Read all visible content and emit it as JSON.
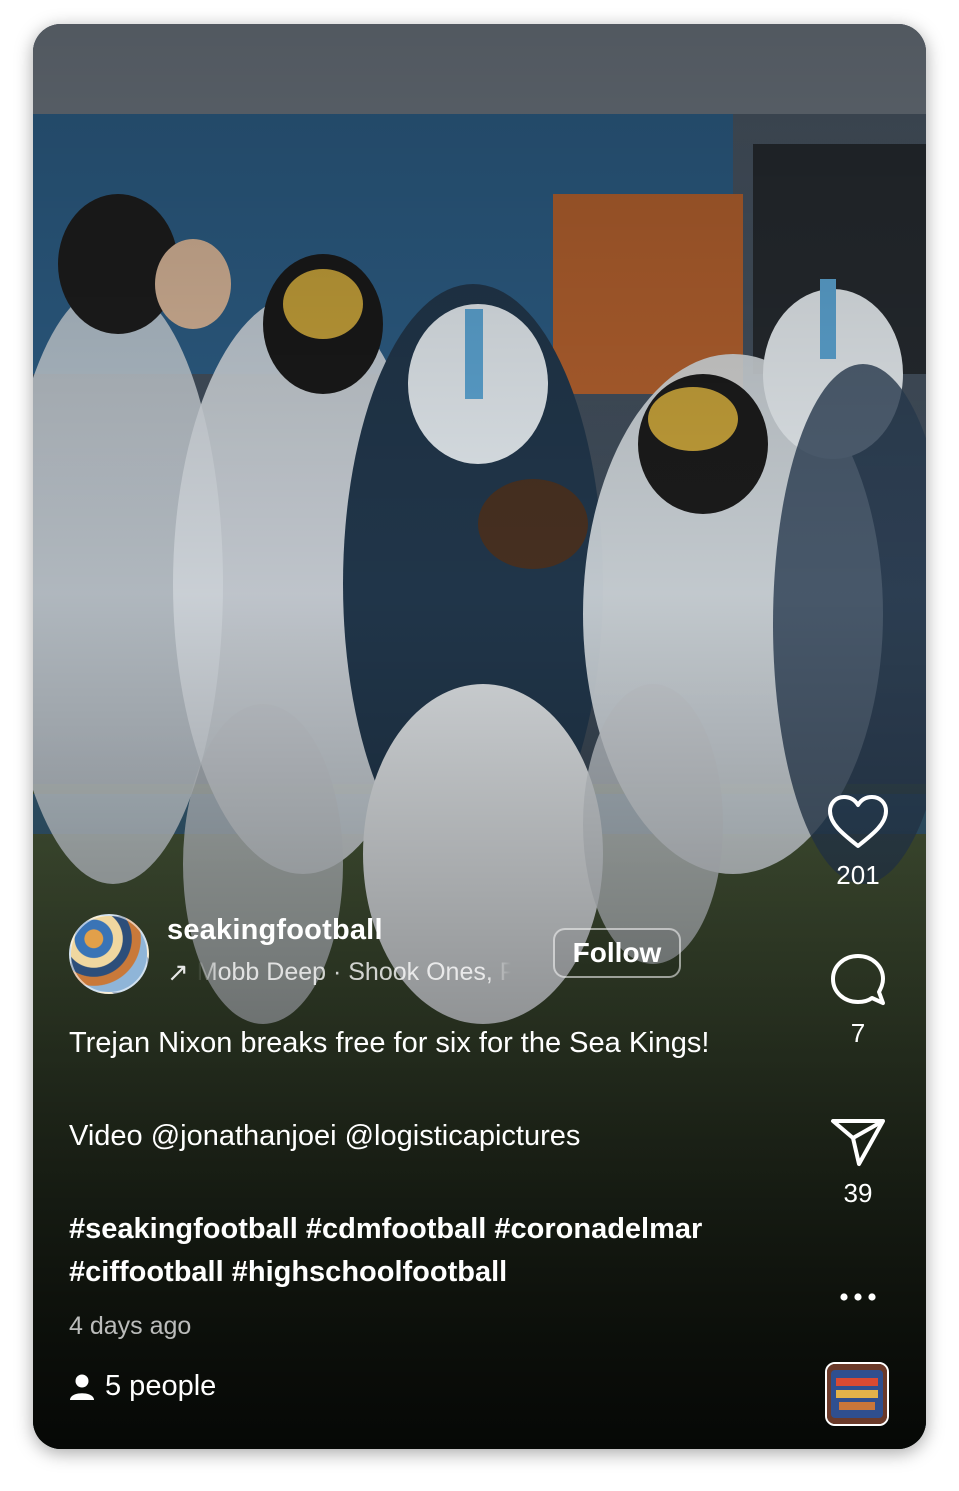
{
  "post": {
    "username": "seakingfootball",
    "music": "Mobb Deep · Shook Ones, Pt. II",
    "follow_label": "Follow",
    "caption_line1": "Trejan Nixon breaks free for six for the Sea Kings!",
    "caption_line2": "Video @jonathanjoei @logisticapictures",
    "caption_tags_line1": "#seakingfootball #cdmfootball #coronadelmar",
    "caption_tags_line2": "#ciffootball #highschoolfootball",
    "timestamp": "4 days ago"
  },
  "actions": {
    "likes": "201",
    "comments": "7",
    "shares": "39"
  },
  "viewers": {
    "label": "5 people"
  },
  "icons": {
    "like": "heart-icon",
    "comment": "comment-bubble-icon",
    "share": "paper-plane-icon",
    "more": "more-dots-icon",
    "music": "music-arrow-icon",
    "people": "person-icon"
  }
}
